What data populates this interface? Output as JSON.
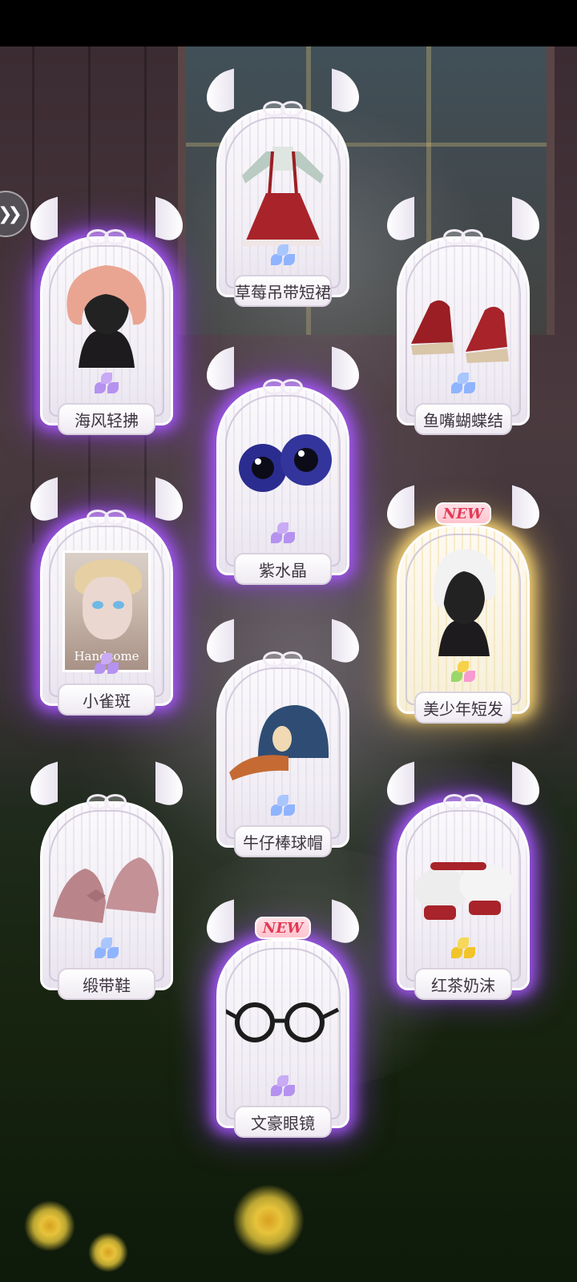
{
  "cards": [
    {
      "id": "skirt",
      "name": "草莓吊带短裙",
      "glow": "none",
      "is_new": false,
      "gem": "blue",
      "item": "strawberry-suspender-skirt"
    },
    {
      "id": "hair-pink",
      "name": "海风轻拂",
      "glow": "purple",
      "is_new": false,
      "gem": "purple",
      "item": "pink-wavy-hair"
    },
    {
      "id": "red-wedges",
      "name": "鱼嘴蝴蝶结",
      "glow": "none",
      "is_new": false,
      "gem": "blue",
      "item": "red-peep-toe-wedges"
    },
    {
      "id": "eyes",
      "name": "紫水晶",
      "glow": "purple",
      "is_new": false,
      "gem": "purple",
      "item": "blue-eyes"
    },
    {
      "id": "makeup",
      "name": "小雀斑",
      "glow": "purple",
      "is_new": false,
      "gem": "purple",
      "item": "freckles-makeup",
      "photo_caption": "Handsome"
    },
    {
      "id": "hair-white",
      "name": "美少年短发",
      "glow": "gold",
      "is_new": true,
      "gem": "rainbow",
      "item": "white-short-hair"
    },
    {
      "id": "cap",
      "name": "牛仔棒球帽",
      "glow": "none",
      "is_new": false,
      "gem": "blue",
      "item": "denim-baseball-cap"
    },
    {
      "id": "ribbon-shoes",
      "name": "缎带鞋",
      "glow": "none",
      "is_new": false,
      "gem": "blue",
      "item": "pink-ribbon-shoes"
    },
    {
      "id": "sleeves",
      "name": "红茶奶沫",
      "glow": "purple",
      "is_new": false,
      "gem": "gold",
      "item": "lace-puff-sleeves"
    },
    {
      "id": "glasses",
      "name": "文豪眼镜",
      "glow": "purple",
      "is_new": true,
      "gem": "purple",
      "item": "round-glasses"
    }
  ],
  "new_label": "NEW",
  "colors": {
    "gem_blue": "#8fb4ff",
    "gem_purple": "#b592f0",
    "gem_gold": "#f2c429",
    "glow_purple": "#aa5aff",
    "glow_gold": "#ffdc78"
  },
  "side_button_icon": "double-chevron-right-icon"
}
